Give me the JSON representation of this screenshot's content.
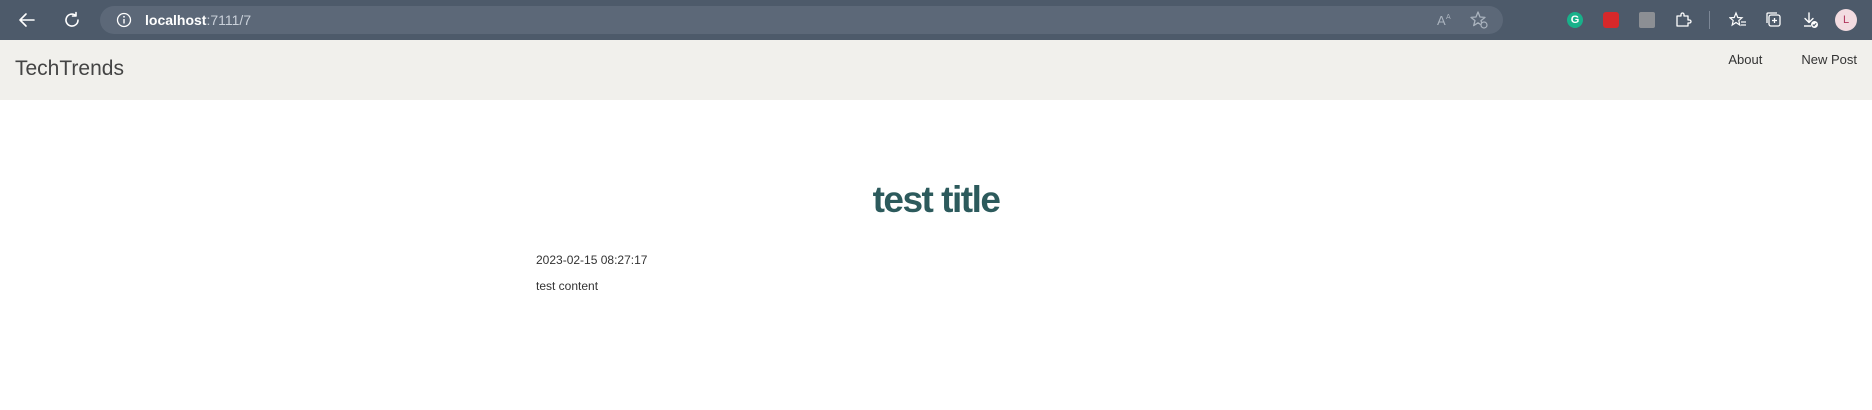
{
  "browser": {
    "url_host": "localhost",
    "url_rest": ":7111/7",
    "profile_initial": "L",
    "extension_g_label": "G"
  },
  "site": {
    "brand": "TechTrends",
    "nav": {
      "about": "About",
      "new_post": "New Post"
    }
  },
  "post": {
    "title": "test title",
    "created": "2023-02-15 08:27:17",
    "content": "test content"
  },
  "colors": {
    "chrome_bg": "#4d5a6a",
    "navbar_bg": "#f1f0ec",
    "title_color": "#2c5a5c"
  }
}
